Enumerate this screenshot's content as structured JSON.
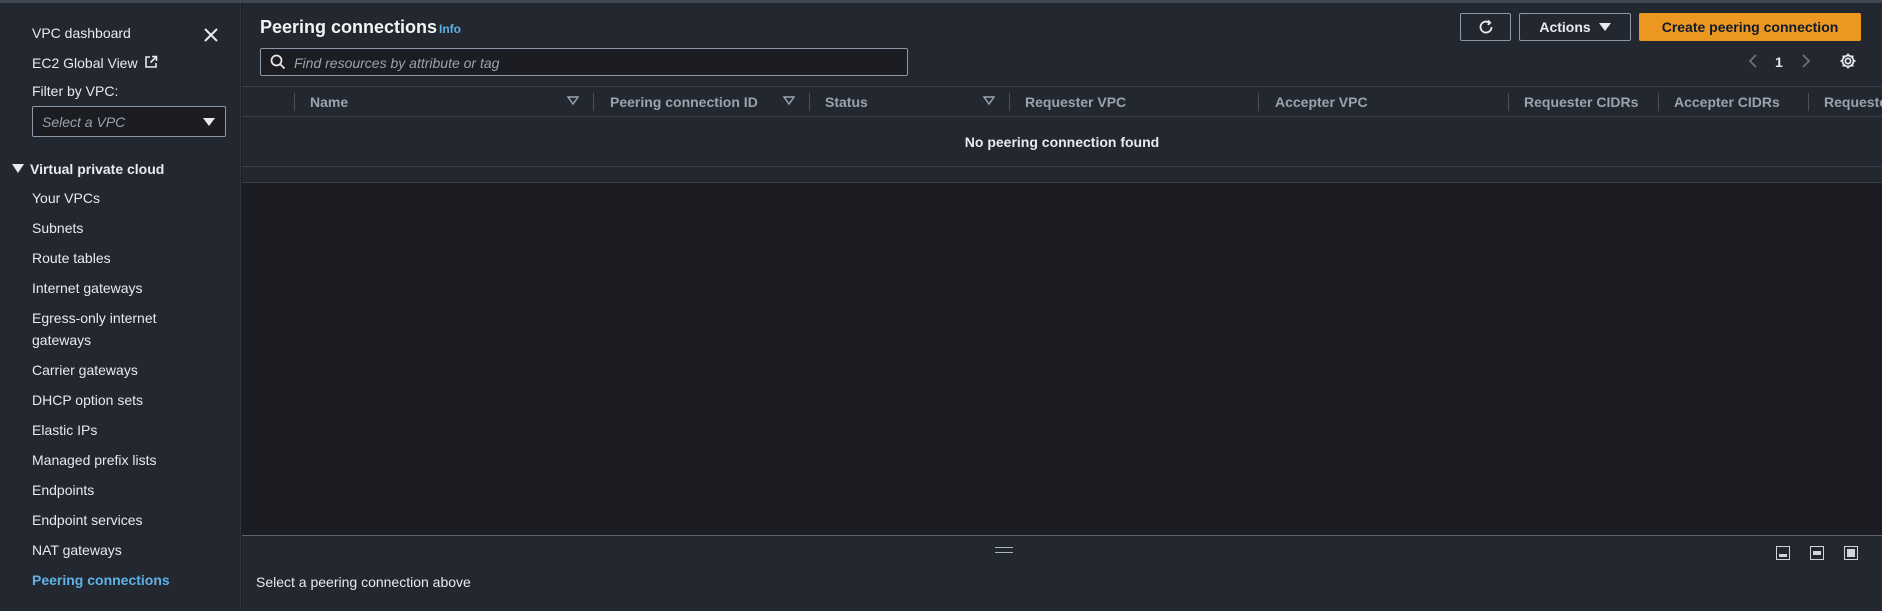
{
  "sidebar": {
    "dashboard": "VPC dashboard",
    "ec2_global_view": "EC2 Global View",
    "filter_label": "Filter by VPC:",
    "filter_placeholder": "Select a VPC",
    "section_title": "Virtual private cloud",
    "items": [
      {
        "label": "Your VPCs"
      },
      {
        "label": "Subnets"
      },
      {
        "label": "Route tables"
      },
      {
        "label": "Internet gateways"
      },
      {
        "label": "Egress-only internet gateways"
      },
      {
        "label": "Carrier gateways"
      },
      {
        "label": "DHCP option sets"
      },
      {
        "label": "Elastic IPs"
      },
      {
        "label": "Managed prefix lists"
      },
      {
        "label": "Endpoints"
      },
      {
        "label": "Endpoint services"
      },
      {
        "label": "NAT gateways"
      },
      {
        "label": "Peering connections",
        "active": true
      }
    ]
  },
  "header": {
    "title": "Peering connections",
    "info": "Info",
    "actions_label": "Actions",
    "create_label": "Create peering connection",
    "search_placeholder": "Find resources by attribute or tag",
    "page": "1"
  },
  "table": {
    "columns": [
      "Name",
      "Peering connection ID",
      "Status",
      "Requester VPC",
      "Accepter VPC",
      "Requester CIDRs",
      "Accepter CIDRs",
      "Requeste"
    ],
    "empty_message": "No peering connection found"
  },
  "split_panel": {
    "message": "Select a peering connection above"
  },
  "colors": {
    "accent": "#5fb2e5",
    "primary_button": "#ec9720",
    "background": "#1b1d22",
    "panel": "#232730"
  },
  "icons": [
    "close-icon",
    "external-link-icon",
    "refresh-icon",
    "search-icon",
    "chevron-left-icon",
    "chevron-right-icon",
    "settings-icon",
    "sort-icon"
  ]
}
